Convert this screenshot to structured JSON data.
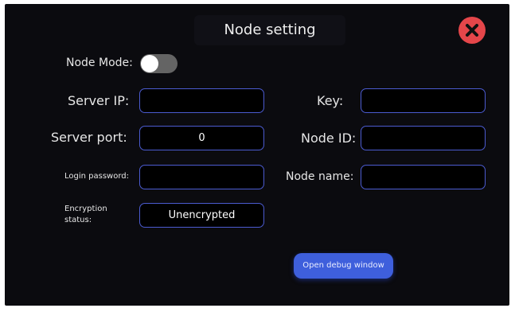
{
  "dialog": {
    "title": "Node setting",
    "close_icon": "close-icon",
    "colors": {
      "background": "#0b0b0f",
      "field_border": "#4b5bd0",
      "accent": "#3e5fdc",
      "close": "#e5464a",
      "toggle_off": "#646464"
    }
  },
  "node_mode": {
    "label": "Node Mode:",
    "enabled": false
  },
  "fields": {
    "server_ip": {
      "label": "Server IP:",
      "value": ""
    },
    "server_port": {
      "label": "Server port:",
      "value": "0"
    },
    "login_password": {
      "label": "Login password:",
      "value": ""
    },
    "encryption_status": {
      "label_line1": "Encryption",
      "label_line2": "status:",
      "value": "Unencrypted"
    },
    "key": {
      "label": "Key:",
      "value": ""
    },
    "node_id": {
      "label": "Node ID:",
      "value": ""
    },
    "node_name": {
      "label": "Node name:",
      "value": ""
    }
  },
  "debug_button": {
    "label": "Open debug window"
  }
}
